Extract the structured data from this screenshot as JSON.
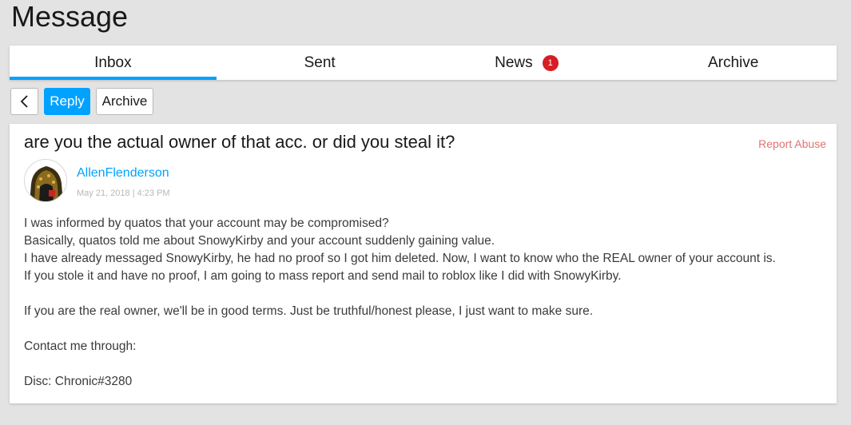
{
  "page": {
    "title": "Message"
  },
  "tabs": [
    {
      "label": "Inbox",
      "active": true
    },
    {
      "label": "Sent",
      "active": false
    },
    {
      "label": "News",
      "active": false,
      "badge": "1"
    },
    {
      "label": "Archive",
      "active": false
    }
  ],
  "toolbar": {
    "back_icon": "chevron-left-icon",
    "reply_label": "Reply",
    "archive_label": "Archive"
  },
  "message": {
    "subject": "are you the actual owner of that acc. or did you steal it?",
    "report_label": "Report Abuse",
    "sender": "AllenFlenderson",
    "date": "May 21, 2018 | 4:23 PM",
    "lines": [
      "I was informed by quatos that your account may be compromised?",
      "Basically, quatos told me about SnowyKirby and your account suddenly gaining value.",
      "I have already messaged SnowyKirby, he had no proof so I got him deleted. Now, I want to know who the REAL owner of your account is.",
      "If you stole it and have no proof, I am going to mass report and send mail to roblox like I did with SnowyKirby.",
      "",
      "If you are the real owner, we'll be in good terms. Just be truthful/honest please, I just want to make sure.",
      "",
      "Contact me through:",
      "",
      "Disc: Chronic#3280"
    ]
  },
  "colors": {
    "accent": "#00a2ff",
    "badge": "#d71d24",
    "report": "#e0736f",
    "background": "#e3e3e3"
  }
}
